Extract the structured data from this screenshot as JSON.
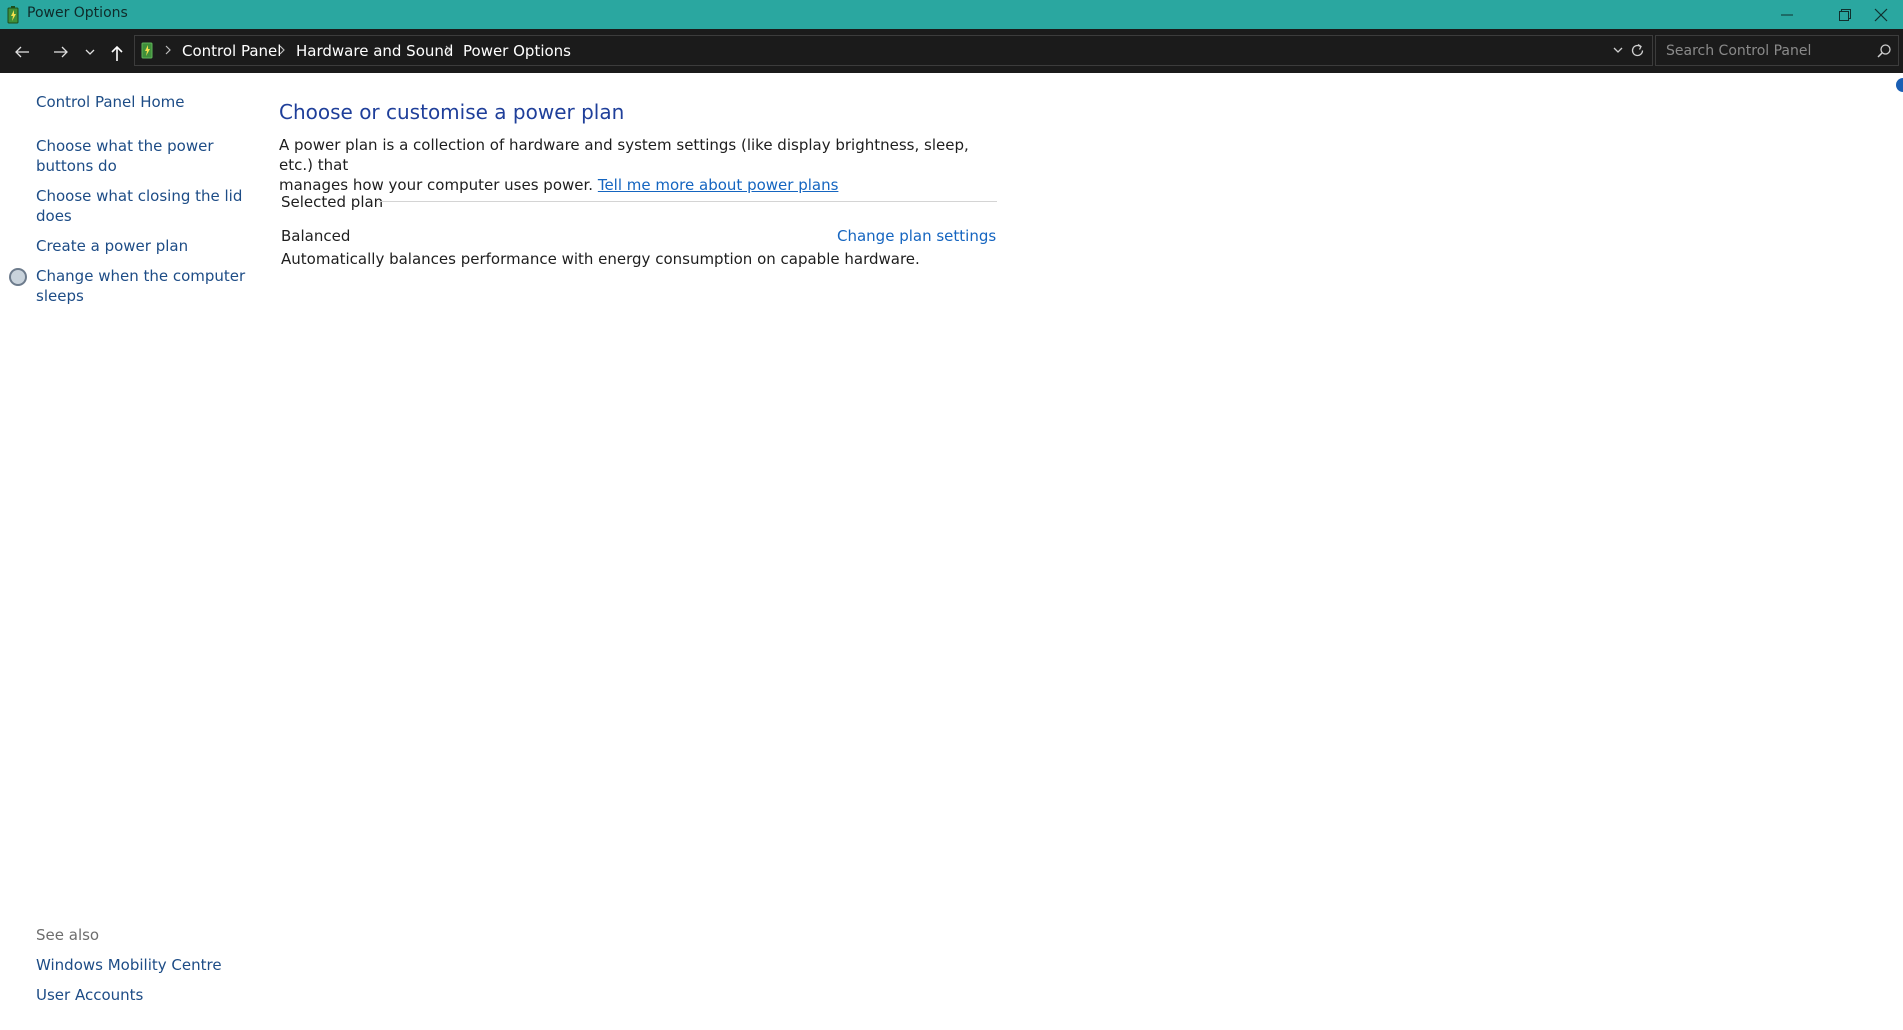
{
  "window": {
    "title": "Power Options",
    "icon": "power-options-icon",
    "controls": [
      "minimize-icon",
      "restore-icon",
      "close-icon"
    ]
  },
  "navigation": {
    "buttons": [
      "back-arrow-icon",
      "forward-arrow-icon",
      "recent-locations-chevron-icon",
      "up-arrow-icon"
    ],
    "breadcrumb": [
      "Control Panel",
      "Hardware and Sound",
      "Power Options"
    ],
    "search_placeholder": "Search Control Panel"
  },
  "sidebar": {
    "home": "Control Panel Home",
    "items": [
      {
        "line1": "Choose what the power",
        "line2": "buttons do"
      },
      {
        "line1": "Choose what closing the lid",
        "line2": "does"
      },
      {
        "line1": "Create a power plan",
        "line2": ""
      },
      {
        "line1": "Change when the computer",
        "line2": "sleeps"
      }
    ],
    "see_also": {
      "heading": "See also",
      "links": [
        "Windows Mobility Centre",
        "User Accounts"
      ]
    }
  },
  "main": {
    "heading": "Choose or customise a power plan",
    "description_line1": "A power plan is a collection of hardware and system settings (like display brightness, sleep, etc.) that",
    "description_line2": "manages how your computer uses power.",
    "learn_more": "Tell me more about power plans",
    "group_label": "Selected plan",
    "plan": {
      "name": "Balanced",
      "settings_link": "Change plan settings",
      "description": "Automatically balances performance with energy consumption on capable hardware."
    }
  },
  "colors": {
    "titlebar": "#2aa7a0",
    "navbar": "#1b1b1b",
    "link": "#1565c0",
    "heading": "#1f3f9a"
  }
}
